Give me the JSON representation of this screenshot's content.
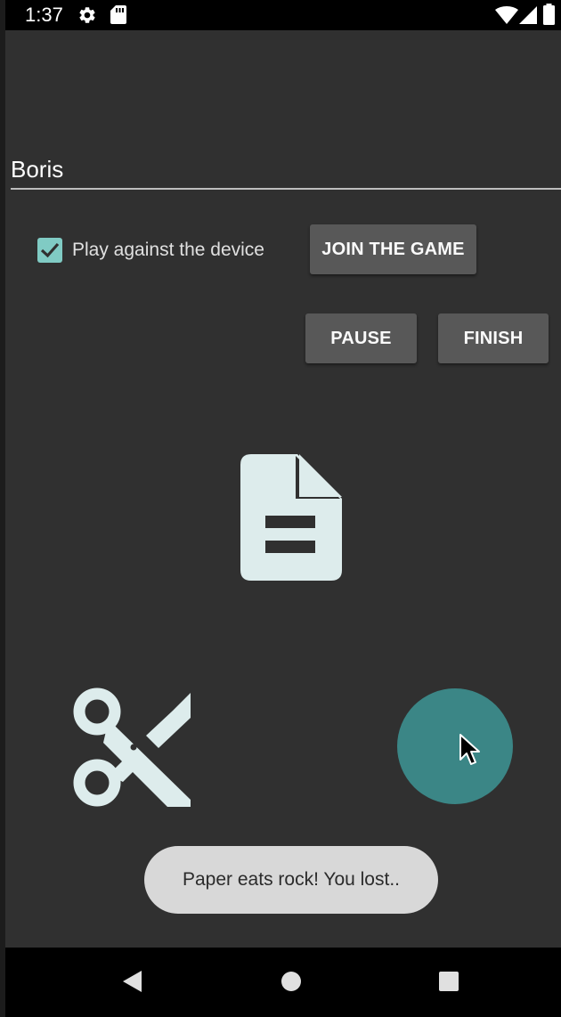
{
  "status_bar": {
    "time": "1:37",
    "icons": [
      "settings-gear-icon",
      "sd-card-icon",
      "wifi-icon",
      "cell-signal-icon",
      "battery-icon"
    ]
  },
  "name_input": {
    "value": "Boris"
  },
  "options": {
    "play_against_device_label": "Play against the device",
    "play_against_device_checked": true
  },
  "buttons": {
    "join": "JOIN THE GAME",
    "pause": "PAUSE",
    "finish": "FINISH"
  },
  "choices": [
    "paper-icon",
    "scissors-icon",
    "rock-button"
  ],
  "toast": {
    "message": "Paper eats rock! You lost.."
  },
  "navigation": [
    "back-icon",
    "home-icon",
    "recents-icon"
  ],
  "colors": {
    "background": "#303030",
    "accent": "#80cbc4",
    "icon": "#ddecec",
    "rock": "#3b8686",
    "button": "#585858",
    "toast": "#d8d8d8"
  }
}
